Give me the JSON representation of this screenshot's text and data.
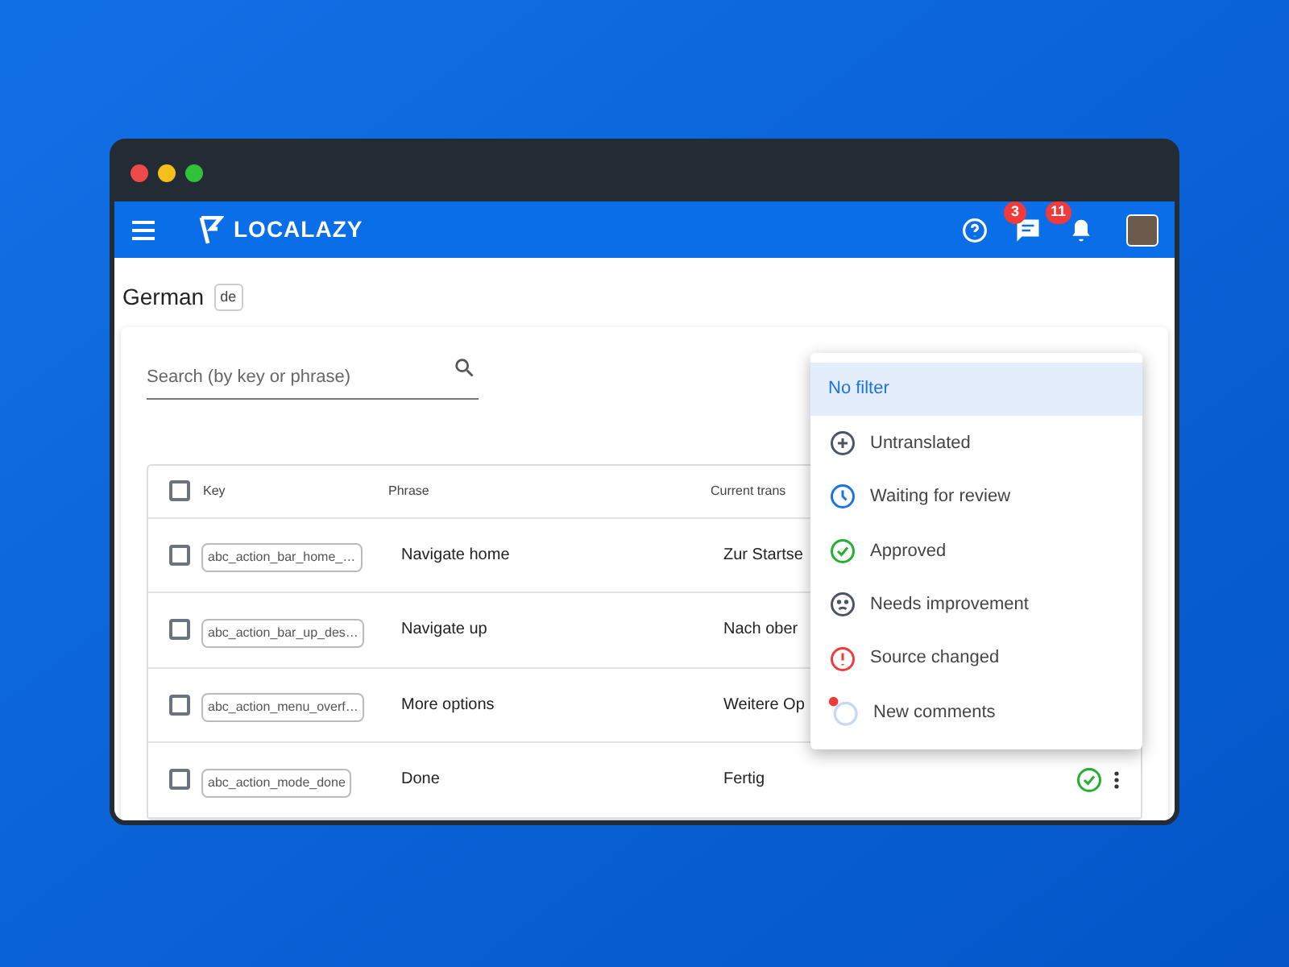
{
  "app_bar": {
    "brand": "LOCALAZY",
    "chat_badge": "3",
    "notification_badge": "11"
  },
  "language": {
    "name": "German",
    "code": "de"
  },
  "search": {
    "placeholder": "Search (by key or phrase)"
  },
  "table": {
    "all_checked": false,
    "columns": [
      "Key",
      "Phrase",
      "Current trans"
    ],
    "rows": [
      {
        "key": "abc_action_bar_home_…",
        "phrase": "Navigate home",
        "translation": "Zur Startse",
        "checked": false
      },
      {
        "key": "abc_action_bar_up_des…",
        "phrase": "Navigate up",
        "translation": "Nach ober",
        "checked": false
      },
      {
        "key": "abc_action_menu_overf…",
        "phrase": "More options",
        "translation": "Weitere Op",
        "checked": false
      },
      {
        "key": "abc_action_mode_done",
        "phrase": "Done",
        "translation": "Fertig",
        "checked": false,
        "kind": "approved"
      }
    ]
  },
  "filter_menu": {
    "items": [
      {
        "label": "No filter",
        "kind": "none",
        "selected": true
      },
      {
        "label": "Untranslated",
        "kind": "untranslated",
        "selected": false
      },
      {
        "label": "Waiting for review",
        "kind": "waiting",
        "selected": false
      },
      {
        "label": "Approved",
        "kind": "approved",
        "selected": false
      },
      {
        "label": "Needs improvement",
        "kind": "improve",
        "selected": false
      },
      {
        "label": "Source changed",
        "kind": "source",
        "selected": false
      },
      {
        "label": "New comments",
        "kind": "comments",
        "selected": false
      }
    ]
  }
}
